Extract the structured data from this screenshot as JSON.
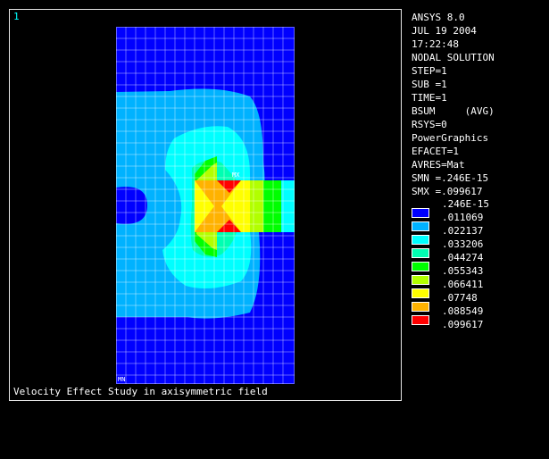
{
  "window": {
    "number": "1"
  },
  "caption": "Velocity Effect Study in axisymmetric field",
  "info": [
    "ANSYS 8.0",
    "JUL 19 2004",
    "17:22:48",
    "NODAL SOLUTION",
    "STEP=1",
    "SUB =1",
    "TIME=1",
    "BSUM     (AVG)",
    "RSYS=0",
    "PowerGraphics",
    "EFACET=1",
    "AVRES=Mat",
    "SMN =.246E-15",
    "SMX =.099617"
  ],
  "legend": {
    "top_label": ".246E-15",
    "items": [
      {
        "label": ".011069",
        "color": "#0000ff"
      },
      {
        "label": ".022137",
        "color": "#00b2ff"
      },
      {
        "label": ".033206",
        "color": "#00ffff"
      },
      {
        "label": ".044274",
        "color": "#00ffb2"
      },
      {
        "label": ".055343",
        "color": "#00ff00"
      },
      {
        "label": ".066411",
        "color": "#b2ff00"
      },
      {
        "label": ".07748",
        "color": "#ffff00"
      },
      {
        "label": ".088549",
        "color": "#ffb200"
      },
      {
        "label": ".099617",
        "color": "#ff0000"
      }
    ]
  },
  "tags": {
    "max": "MX",
    "min": "MN"
  }
}
